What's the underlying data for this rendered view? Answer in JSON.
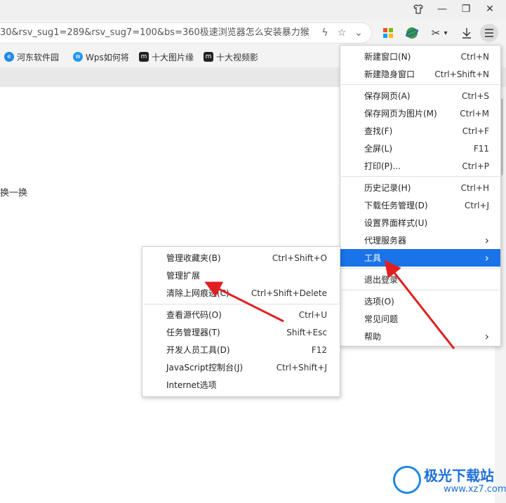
{
  "window_controls": {
    "skin_icon": "skin-icon",
    "min": "—",
    "max": "❐",
    "close": "✕"
  },
  "address": {
    "url": "30&rsv_sug1=289&rsv_sug7=100&bs=360极速浏览器怎么安装暴力猴",
    "icons": [
      "lightning-icon",
      "star-icon",
      "chevron-down-icon"
    ]
  },
  "toolbar": [
    "apps-icon",
    "globe-icon",
    "scissors-icon",
    "download-icon",
    "menu-icon"
  ],
  "bookmarks": [
    {
      "label": "河东软件园"
    },
    {
      "label": "Wps如何将"
    },
    {
      "label": "十大图片缘"
    },
    {
      "label": "十大视频影"
    }
  ],
  "page": {
    "text": "换一换"
  },
  "main_menu": {
    "items": [
      {
        "label": "新建窗口(N)",
        "shortcut": "Ctrl+N"
      },
      {
        "label": "新建隐身窗口",
        "shortcut": "Ctrl+Shift+N"
      },
      {
        "label": "保存网页(A)",
        "shortcut": "Ctrl+S"
      },
      {
        "label": "保存网页为图片(M)",
        "shortcut": "Ctrl+M"
      },
      {
        "label": "查找(F)",
        "shortcut": "Ctrl+F"
      },
      {
        "label": "全屏(L)",
        "shortcut": "F11"
      },
      {
        "label": "打印(P)...",
        "shortcut": "Ctrl+P"
      },
      {
        "label": "历史记录(H)",
        "shortcut": "Ctrl+H"
      },
      {
        "label": "下载任务管理(D)",
        "shortcut": "Ctrl+J"
      },
      {
        "label": "设置界面样式(U)",
        "shortcut": ""
      },
      {
        "label": "代理服务器",
        "shortcut": "›"
      },
      {
        "label": "工具",
        "shortcut": "›",
        "selected": true
      },
      {
        "label": "退出登录",
        "shortcut": ""
      },
      {
        "label": "选项(O)",
        "shortcut": ""
      },
      {
        "label": "常见问题",
        "shortcut": ""
      },
      {
        "label": "帮助",
        "shortcut": "›"
      }
    ]
  },
  "tools_submenu": {
    "items": [
      {
        "label": "管理收藏夹(B)",
        "shortcut": "Ctrl+Shift+O"
      },
      {
        "label": "管理扩展",
        "shortcut": ""
      },
      {
        "label": "清除上网痕迹(C)",
        "shortcut": "Ctrl+Shift+Delete"
      },
      {
        "label": "查看源代码(O)",
        "shortcut": "Ctrl+U"
      },
      {
        "label": "任务管理器(T)",
        "shortcut": "Shift+Esc"
      },
      {
        "label": "开发人员工具(D)",
        "shortcut": "F12"
      },
      {
        "label": "JavaScript控制台(J)",
        "shortcut": "Ctrl+Shift+J"
      },
      {
        "label": "Internet选项",
        "shortcut": ""
      }
    ]
  },
  "annotation_color": "#e02020",
  "accent_color": "#1a73e8",
  "watermark": {
    "brand": "极光下载站",
    "site": "www.xz7.com"
  }
}
